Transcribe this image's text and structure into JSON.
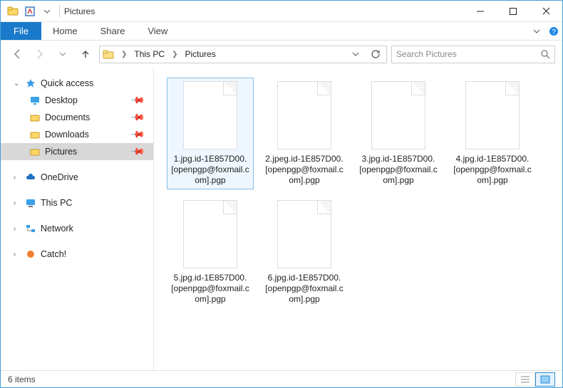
{
  "titlebar": {
    "title": "Pictures"
  },
  "ribbon": {
    "file": "File",
    "tabs": [
      "Home",
      "Share",
      "View"
    ]
  },
  "address": {
    "crumbs": [
      "This PC",
      "Pictures"
    ]
  },
  "search": {
    "placeholder": "Search Pictures"
  },
  "sidebar": {
    "quick_access": "Quick access",
    "quick_items": [
      {
        "label": "Desktop",
        "pinned": true,
        "icon": "desktop"
      },
      {
        "label": "Documents",
        "pinned": true,
        "icon": "folder"
      },
      {
        "label": "Downloads",
        "pinned": true,
        "icon": "folder"
      },
      {
        "label": "Pictures",
        "pinned": true,
        "icon": "folder",
        "selected": true
      }
    ],
    "onedrive": "OneDrive",
    "thispc": "This PC",
    "network": "Network",
    "catch": "Catch!"
  },
  "files": [
    {
      "name": "1.jpg.id-1E857D00.[openpgp@foxmail.com].pgp",
      "selected": true
    },
    {
      "name": "2.jpeg.id-1E857D00.[openpgp@foxmail.com].pgp"
    },
    {
      "name": "3.jpg.id-1E857D00.[openpgp@foxmail.com].pgp"
    },
    {
      "name": "4.jpg.id-1E857D00.[openpgp@foxmail.com].pgp"
    },
    {
      "name": "5.jpg.id-1E857D00.[openpgp@foxmail.com].pgp"
    },
    {
      "name": "6.jpg.id-1E857D00.[openpgp@foxmail.com].pgp"
    }
  ],
  "statusbar": {
    "count_label": "6 items"
  }
}
